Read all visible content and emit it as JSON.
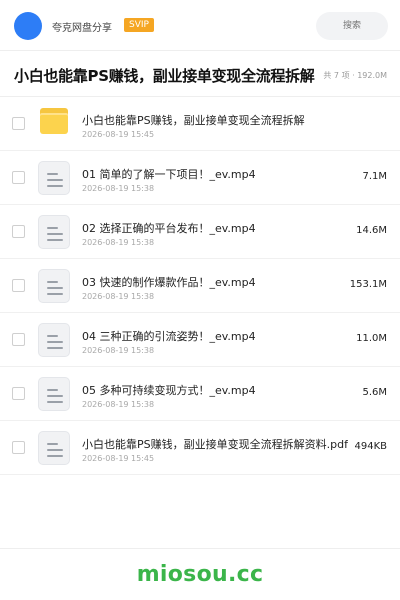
{
  "header": {
    "brand": "夸克网盘分享",
    "badge": "SVIP",
    "search_placeholder": "搜索"
  },
  "share": {
    "title": "小白也能靠PS赚钱，副业接单变现全流程拆解",
    "summary": "共 7 项 · 192.0M"
  },
  "files": [
    {
      "name": "小白也能靠PS赚钱，副业接单变现全流程拆解",
      "date": "2026-08-19 15:45",
      "size": "",
      "icon": "folder-icon"
    },
    {
      "name": "01 简单的了解一下项目！_ev.mp4",
      "date": "2026-08-19 15:38",
      "size": "7.1M",
      "icon": "document-icon"
    },
    {
      "name": "02 选择正确的平台发布！_ev.mp4",
      "date": "2026-08-19 15:38",
      "size": "14.6M",
      "icon": "document-icon"
    },
    {
      "name": "03 快速的制作爆款作品！_ev.mp4",
      "date": "2026-08-19 15:38",
      "size": "153.1M",
      "icon": "document-icon"
    },
    {
      "name": "04 三种正确的引流姿势！_ev.mp4",
      "date": "2026-08-19 15:38",
      "size": "11.0M",
      "icon": "document-icon"
    },
    {
      "name": "05 多种可持续变现方式！_ev.mp4",
      "date": "2026-08-19 15:38",
      "size": "5.6M",
      "icon": "document-icon"
    },
    {
      "name": "小白也能靠PS赚钱，副业接单变现全流程拆解资料.pdf",
      "date": "2026-08-19 15:45",
      "size": "494KB",
      "icon": "document-icon"
    }
  ],
  "footer": {
    "watermark": "miosou.cc"
  },
  "colors": {
    "accent": "#2d7df6",
    "badge": "#f5a623",
    "folder": "#fcd34d",
    "watermark": "#3bb54a"
  }
}
